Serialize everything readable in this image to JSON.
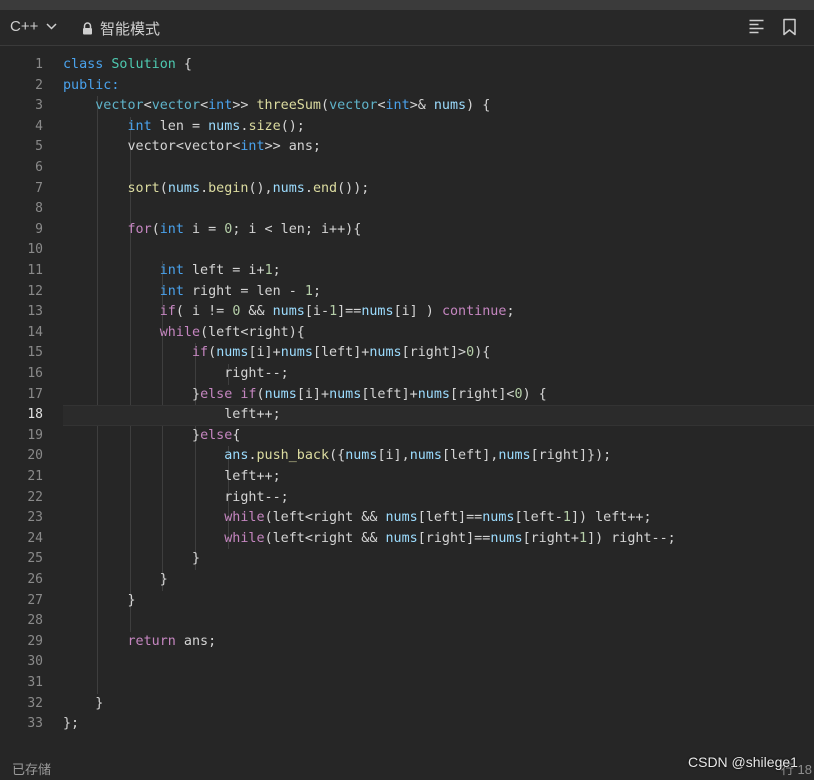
{
  "toolbar": {
    "language": "C++",
    "mode_label": "智能模式"
  },
  "editor": {
    "active_line": 18,
    "lines": [
      [
        {
          "t": "class ",
          "c": "kw"
        },
        {
          "t": "Solution",
          "c": "cls"
        },
        {
          "t": " {"
        }
      ],
      [
        {
          "t": "public:",
          "c": "kw"
        }
      ],
      [
        {
          "t": "    "
        },
        {
          "t": "vector",
          "c": "ty"
        },
        {
          "t": "<"
        },
        {
          "t": "vector",
          "c": "ty"
        },
        {
          "t": "<"
        },
        {
          "t": "int",
          "c": "kw"
        },
        {
          "t": ">> "
        },
        {
          "t": "threeSum",
          "c": "fn"
        },
        {
          "t": "("
        },
        {
          "t": "vector",
          "c": "ty"
        },
        {
          "t": "<"
        },
        {
          "t": "int",
          "c": "kw"
        },
        {
          "t": ">& "
        },
        {
          "t": "nums",
          "c": "var"
        },
        {
          "t": ") {"
        }
      ],
      [
        {
          "t": "        "
        },
        {
          "t": "int",
          "c": "kw"
        },
        {
          "t": " len = "
        },
        {
          "t": "nums",
          "c": "var"
        },
        {
          "t": "."
        },
        {
          "t": "size",
          "c": "fn"
        },
        {
          "t": "();"
        }
      ],
      [
        {
          "t": "        vector<vector<"
        },
        {
          "t": "int",
          "c": "kw"
        },
        {
          "t": ">> ans;"
        }
      ],
      [],
      [
        {
          "t": "        "
        },
        {
          "t": "sort",
          "c": "fn"
        },
        {
          "t": "("
        },
        {
          "t": "nums",
          "c": "var"
        },
        {
          "t": "."
        },
        {
          "t": "begin",
          "c": "fn"
        },
        {
          "t": "(),"
        },
        {
          "t": "nums",
          "c": "var"
        },
        {
          "t": "."
        },
        {
          "t": "end",
          "c": "fn"
        },
        {
          "t": "());"
        }
      ],
      [],
      [
        {
          "t": "        "
        },
        {
          "t": "for",
          "c": "ctl"
        },
        {
          "t": "("
        },
        {
          "t": "int",
          "c": "kw"
        },
        {
          "t": " i = "
        },
        {
          "t": "0",
          "c": "num"
        },
        {
          "t": "; i < len; i++){"
        }
      ],
      [],
      [
        {
          "t": "            "
        },
        {
          "t": "int",
          "c": "kw"
        },
        {
          "t": " left = i+"
        },
        {
          "t": "1",
          "c": "num"
        },
        {
          "t": ";"
        }
      ],
      [
        {
          "t": "            "
        },
        {
          "t": "int",
          "c": "kw"
        },
        {
          "t": " right = len - "
        },
        {
          "t": "1",
          "c": "num"
        },
        {
          "t": ";"
        }
      ],
      [
        {
          "t": "            "
        },
        {
          "t": "if",
          "c": "ctl"
        },
        {
          "t": "( i != "
        },
        {
          "t": "0",
          "c": "num"
        },
        {
          "t": " && "
        },
        {
          "t": "nums",
          "c": "var"
        },
        {
          "t": "[i-"
        },
        {
          "t": "1",
          "c": "num"
        },
        {
          "t": "]=="
        },
        {
          "t": "nums",
          "c": "var"
        },
        {
          "t": "[i] ) "
        },
        {
          "t": "continue",
          "c": "ctl"
        },
        {
          "t": ";"
        }
      ],
      [
        {
          "t": "            "
        },
        {
          "t": "while",
          "c": "ctl"
        },
        {
          "t": "(left<right){"
        }
      ],
      [
        {
          "t": "                "
        },
        {
          "t": "if",
          "c": "ctl"
        },
        {
          "t": "("
        },
        {
          "t": "nums",
          "c": "var"
        },
        {
          "t": "[i]+"
        },
        {
          "t": "nums",
          "c": "var"
        },
        {
          "t": "[left]+"
        },
        {
          "t": "nums",
          "c": "var"
        },
        {
          "t": "[right]>"
        },
        {
          "t": "0",
          "c": "num"
        },
        {
          "t": "){"
        }
      ],
      [
        {
          "t": "                    right--;"
        }
      ],
      [
        {
          "t": "                }"
        },
        {
          "t": "else",
          "c": "ctl"
        },
        {
          "t": " "
        },
        {
          "t": "if",
          "c": "ctl"
        },
        {
          "t": "("
        },
        {
          "t": "nums",
          "c": "var"
        },
        {
          "t": "[i]+"
        },
        {
          "t": "nums",
          "c": "var"
        },
        {
          "t": "[left]+"
        },
        {
          "t": "nums",
          "c": "var"
        },
        {
          "t": "[right]<"
        },
        {
          "t": "0",
          "c": "num"
        },
        {
          "t": ") {"
        }
      ],
      [
        {
          "t": "                    left++;"
        }
      ],
      [
        {
          "t": "                }"
        },
        {
          "t": "else",
          "c": "ctl"
        },
        {
          "t": "{"
        }
      ],
      [
        {
          "t": "                    "
        },
        {
          "t": "ans",
          "c": "var"
        },
        {
          "t": "."
        },
        {
          "t": "push_back",
          "c": "fn"
        },
        {
          "t": "({"
        },
        {
          "t": "nums",
          "c": "var"
        },
        {
          "t": "[i],"
        },
        {
          "t": "nums",
          "c": "var"
        },
        {
          "t": "[left],"
        },
        {
          "t": "nums",
          "c": "var"
        },
        {
          "t": "[right]});"
        }
      ],
      [
        {
          "t": "                    left++;"
        }
      ],
      [
        {
          "t": "                    right--;"
        }
      ],
      [
        {
          "t": "                    "
        },
        {
          "t": "while",
          "c": "ctl"
        },
        {
          "t": "(left<right && "
        },
        {
          "t": "nums",
          "c": "var"
        },
        {
          "t": "[left]=="
        },
        {
          "t": "nums",
          "c": "var"
        },
        {
          "t": "[left-"
        },
        {
          "t": "1",
          "c": "num"
        },
        {
          "t": "]) left++;"
        }
      ],
      [
        {
          "t": "                    "
        },
        {
          "t": "while",
          "c": "ctl"
        },
        {
          "t": "(left<right && "
        },
        {
          "t": "nums",
          "c": "var"
        },
        {
          "t": "[right]=="
        },
        {
          "t": "nums",
          "c": "var"
        },
        {
          "t": "[right+"
        },
        {
          "t": "1",
          "c": "num"
        },
        {
          "t": "]) right--;"
        }
      ],
      [
        {
          "t": "                }"
        }
      ],
      [
        {
          "t": "            }"
        }
      ],
      [
        {
          "t": "        }"
        }
      ],
      [],
      [
        {
          "t": "        "
        },
        {
          "t": "return",
          "c": "ctl"
        },
        {
          "t": " ans;"
        }
      ],
      [],
      [],
      [
        {
          "t": "    }"
        }
      ],
      [
        {
          "t": "};"
        }
      ]
    ]
  },
  "status": {
    "saved_label": "已存储",
    "line_position": "行 18",
    "watermark": "CSDN @shilege1"
  }
}
